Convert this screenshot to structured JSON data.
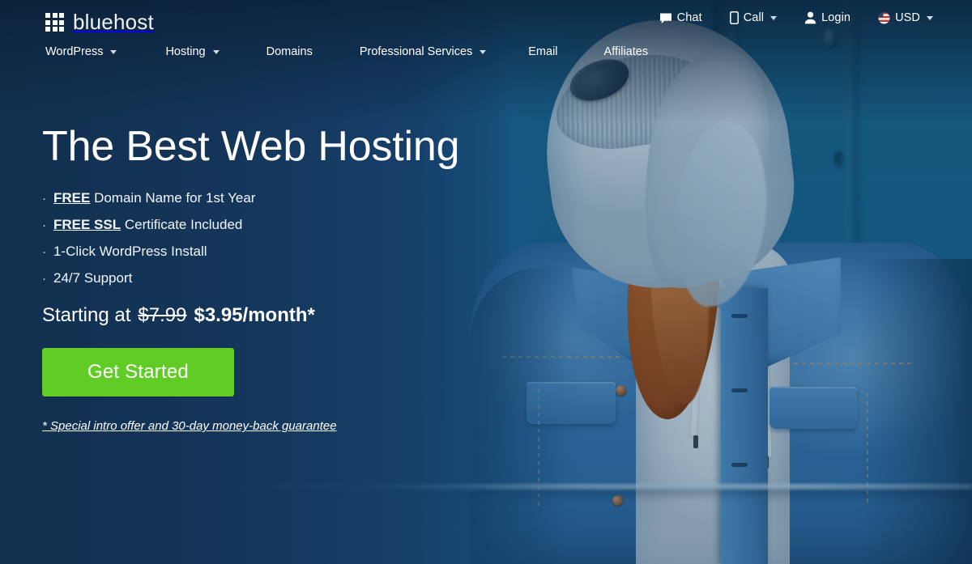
{
  "brand": {
    "name": "bluehost",
    "logo_icon": "grid-squares-icon"
  },
  "utility_bar": {
    "items": [
      {
        "label": "Chat",
        "icon": "chat-bubble-icon",
        "has_caret": false
      },
      {
        "label": "Call",
        "icon": "mobile-phone-icon",
        "has_caret": true
      },
      {
        "label": "Login",
        "icon": "person-icon",
        "has_caret": false
      },
      {
        "label": "USD",
        "icon": "us-flag-circle-icon",
        "has_caret": true
      }
    ]
  },
  "main_nav": {
    "items": [
      {
        "label": "WordPress",
        "has_caret": true
      },
      {
        "label": "Hosting",
        "has_caret": true
      },
      {
        "label": "Domains",
        "has_caret": false
      },
      {
        "label": "Professional Services",
        "has_caret": true
      },
      {
        "label": "Email",
        "has_caret": false
      },
      {
        "label": "Affiliates",
        "has_caret": false
      }
    ]
  },
  "hero": {
    "headline": "The Best Web Hosting",
    "bullets": [
      {
        "bullet": "·",
        "strong": "FREE",
        "rest": " Domain Name for 1st Year"
      },
      {
        "bullet": "·",
        "strong": "FREE SSL",
        "rest": " Certificate Included"
      },
      {
        "bullet": "·",
        "strong": "",
        "rest": "1-Click WordPress Install"
      },
      {
        "bullet": "·",
        "strong": "",
        "rest": "24/7 Support"
      }
    ],
    "price": {
      "prefix": "Starting at",
      "old_price": "$7.99",
      "new_price": "$3.95/month*"
    },
    "cta_label": "Get Started",
    "note": "* Special intro offer and 30-day money-back guarantee"
  },
  "colors": {
    "cta_green": "#61cc26",
    "bg_navy": "#12304f",
    "bg_blue": "#1e5183",
    "photo_teal": "#1a6c95",
    "text_white": "#ffffff"
  }
}
